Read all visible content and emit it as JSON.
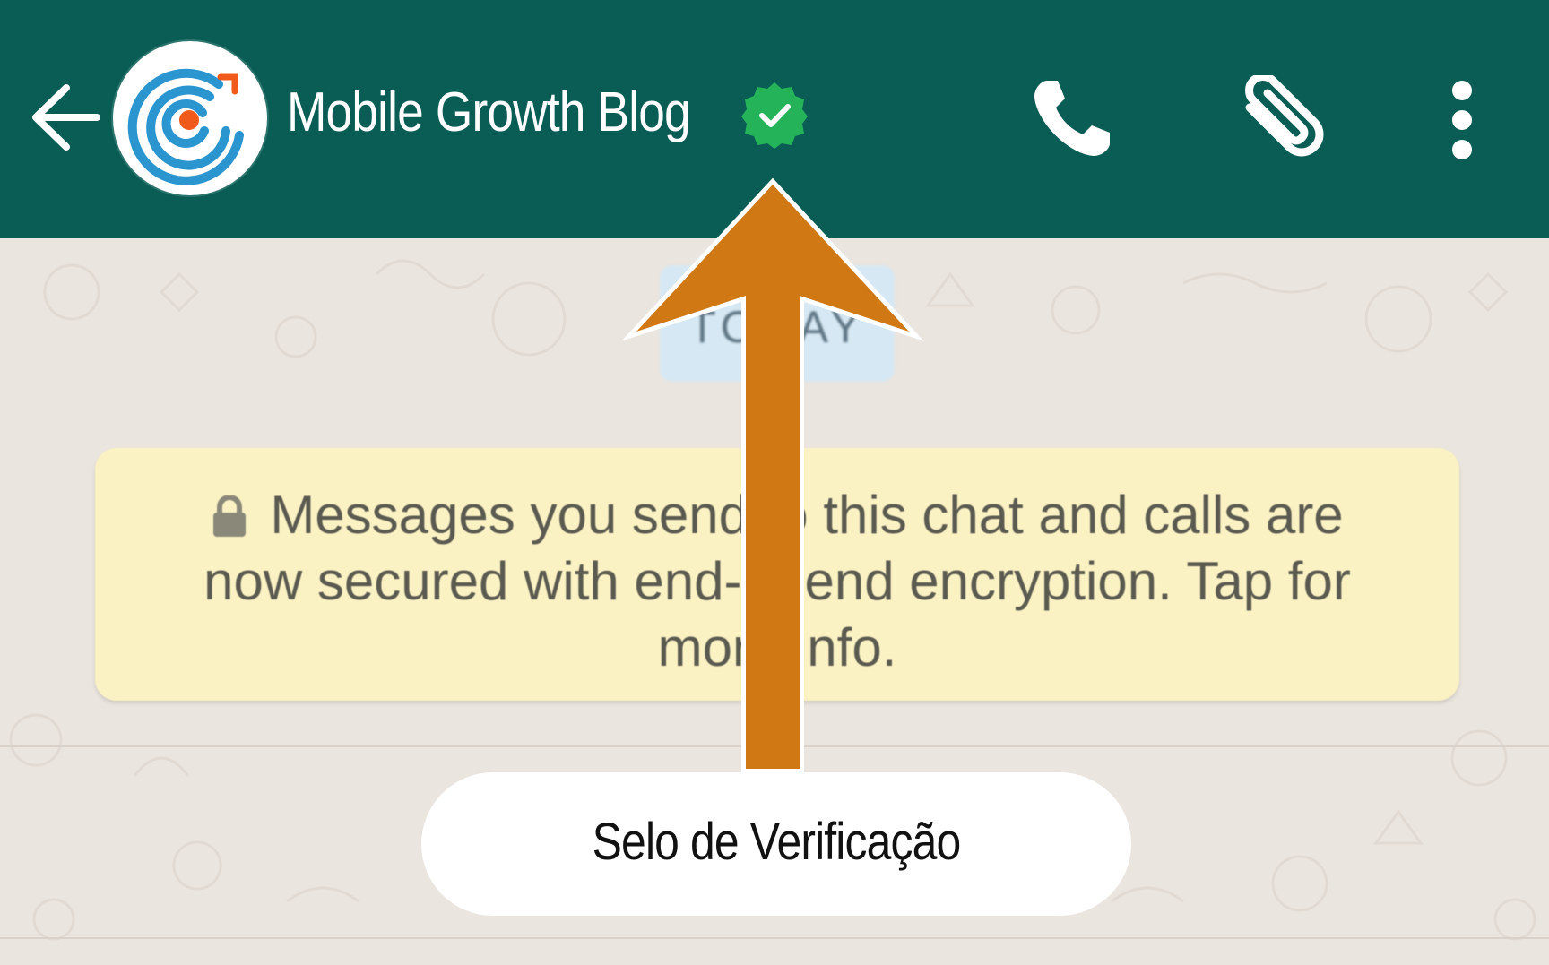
{
  "header": {
    "back_icon": "arrow-left-icon",
    "avatar_icon": "mobile-growth-logo",
    "title": "Mobile Growth Blog",
    "verified_icon": "verified-check-icon",
    "call_icon": "phone-icon",
    "attach_icon": "paperclip-icon",
    "more_icon": "more-vertical-icon"
  },
  "chat": {
    "date_chip": "TODAY",
    "encryption_notice": "Messages you send to this chat and calls are now secured with end-to-end encryption. Tap for more info.",
    "lock_icon": "lock-icon"
  },
  "annotation": {
    "label": "Selo de Verificação",
    "arrow_color": "#d07814"
  },
  "colors": {
    "header": "#0a5d55",
    "verified_badge": "#25b359",
    "notice_bg": "#fbf2c4",
    "chat_bg": "#ebe5df",
    "logo_blue": "#2a95cf",
    "logo_orange": "#f05a1a"
  }
}
